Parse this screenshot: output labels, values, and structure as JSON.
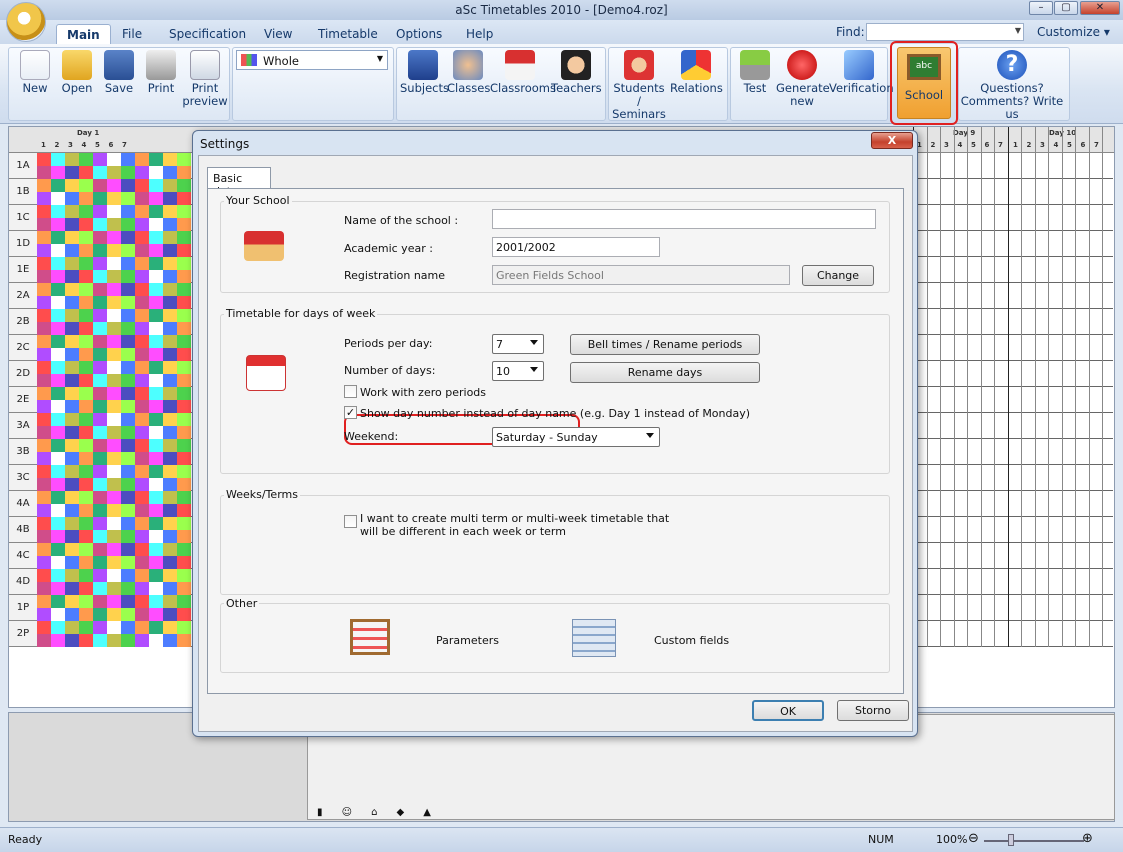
{
  "window": {
    "title": "aSc Timetables 2010  - [Demo4.roz]"
  },
  "menu": {
    "tabs": [
      "Main",
      "File",
      "Specification",
      "View",
      "Timetable",
      "Options",
      "Help"
    ],
    "find_label": "Find:",
    "customize": "Customize"
  },
  "ribbon": {
    "new": "New",
    "open": "Open",
    "save": "Save",
    "print": "Print",
    "print_preview_1": "Print",
    "print_preview_2": "preview",
    "view_select": "Whole",
    "subjects": "Subjects",
    "classes": "Classes",
    "classrooms": "Classrooms",
    "teachers": "Teachers",
    "students_1": "Students /",
    "students_2": "Seminars",
    "relations": "Relations",
    "test": "Test",
    "generate_1": "Generate",
    "generate_2": "new",
    "verification": "Verification",
    "school": "School",
    "questions_1": "Questions?",
    "questions_2": "Comments? Write us"
  },
  "grid": {
    "days": [
      "Day 1",
      "Day 9",
      "Day 10"
    ],
    "periods": [
      "1",
      "2",
      "3",
      "4",
      "5",
      "6",
      "7"
    ],
    "classes": [
      "1A",
      "1B",
      "1C",
      "1D",
      "1E",
      "2A",
      "2B",
      "2C",
      "2D",
      "2E",
      "3A",
      "3B",
      "3C",
      "4A",
      "4B",
      "4C",
      "4D",
      "1P",
      "2P"
    ]
  },
  "status": {
    "ready": "Ready",
    "num": "NUM",
    "zoom": "100%"
  },
  "dialog": {
    "title": "Settings",
    "close": "X",
    "tab": "Basic data",
    "your_school": {
      "group": "Your School",
      "name_label": "Name of the school :",
      "name_value": "",
      "year_label": "Academic year :",
      "year_value": "2001/2002",
      "reg_label": "Registration name",
      "reg_value": "Green Fields School",
      "change": "Change"
    },
    "timetable": {
      "group": "Timetable for days of week",
      "periods_label": "Periods per day:",
      "periods_value": "7",
      "bell": "Bell times / Rename periods",
      "days_label": "Number of days:",
      "days_value": "10",
      "rename_days": "Rename days",
      "zero_periods": "Work with zero periods",
      "show_day_number": "Show day number instead of day name (e.g. Day 1 instead of Monday)",
      "weekend_label": "Weekend:",
      "weekend_value": "Saturday - Sunday"
    },
    "weeks": {
      "group": "Weeks/Terms",
      "multi": "I want to create multi term or multi-week timetable that will be different in each week or term"
    },
    "other": {
      "group": "Other",
      "parameters": "Parameters",
      "custom_fields": "Custom fields"
    },
    "ok": "OK",
    "cancel": "Storno"
  }
}
